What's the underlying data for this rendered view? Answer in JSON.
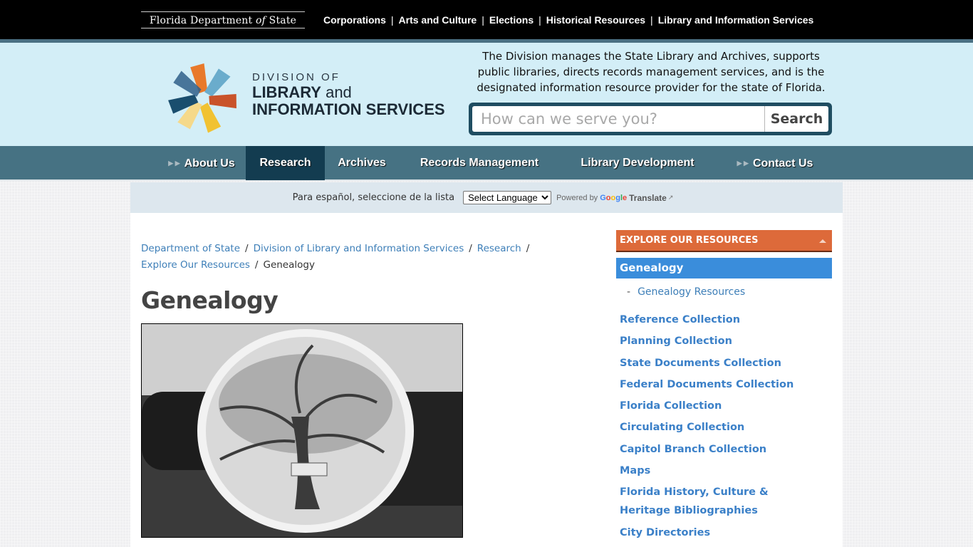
{
  "top_bar": {
    "logo": {
      "pre": "Florida Department ",
      "of": "of",
      "post": " State"
    },
    "links": [
      "Corporations",
      "Arts and Culture",
      "Elections",
      "Historical Resources",
      "Library and Information Services"
    ]
  },
  "header": {
    "logo": {
      "line1": "DIVISION OF",
      "line2_bold": "LIBRARY",
      "line2_light": " and",
      "line3": "INFORMATION SERVICES"
    },
    "tagline": "The Division manages the State Library and Archives, supports public libraries, directs records management services, and is the designated information resource provider for the state of Florida.",
    "search": {
      "placeholder": "How can we serve you?",
      "value": "",
      "button": "Search"
    }
  },
  "main_nav": {
    "items": [
      {
        "label": "About Us",
        "has_submenu": true
      },
      {
        "label": "Research",
        "active": true
      },
      {
        "label": "Archives"
      },
      {
        "label": "Records Management"
      },
      {
        "label": "Library Development"
      },
      {
        "label": "Contact Us",
        "has_submenu": true
      }
    ]
  },
  "translate": {
    "label": "Para español, seleccione de la lista",
    "select_value": "Select Language",
    "powered_by": "Powered by",
    "google": [
      "G",
      "o",
      "o",
      "g",
      "l",
      "e"
    ],
    "translate_link": "Translate"
  },
  "breadcrumb": {
    "items": [
      "Department of State",
      "Division of Library and Information Services",
      "Research",
      "Explore Our Resources"
    ],
    "current": "Genealogy"
  },
  "page": {
    "title": "Genealogy",
    "image_alt": "Black and white photo of a hand-painted family tree plate"
  },
  "sidebar": {
    "heading": "EXPLORE OUR RESOURCES",
    "active": "Genealogy",
    "sub_items": [
      "Genealogy Resources"
    ],
    "items": [
      "Reference Collection",
      "Planning Collection",
      "State Documents Collection",
      "Federal Documents Collection",
      "Florida Collection",
      "Circulating Collection",
      "Capitol Branch Collection",
      "Maps",
      "Florida History, Culture & Heritage Bibliographies",
      "City Directories"
    ]
  },
  "colors": {
    "top_bar": "#000000",
    "header_bg": "#d3eef7",
    "nav_bg": "#467283",
    "nav_active": "#133c50",
    "search_frame": "#1f4d61",
    "sidebar_heading": "#dd6a3a",
    "sidebar_active": "#3a8ddb",
    "link": "#3e7fb8"
  }
}
